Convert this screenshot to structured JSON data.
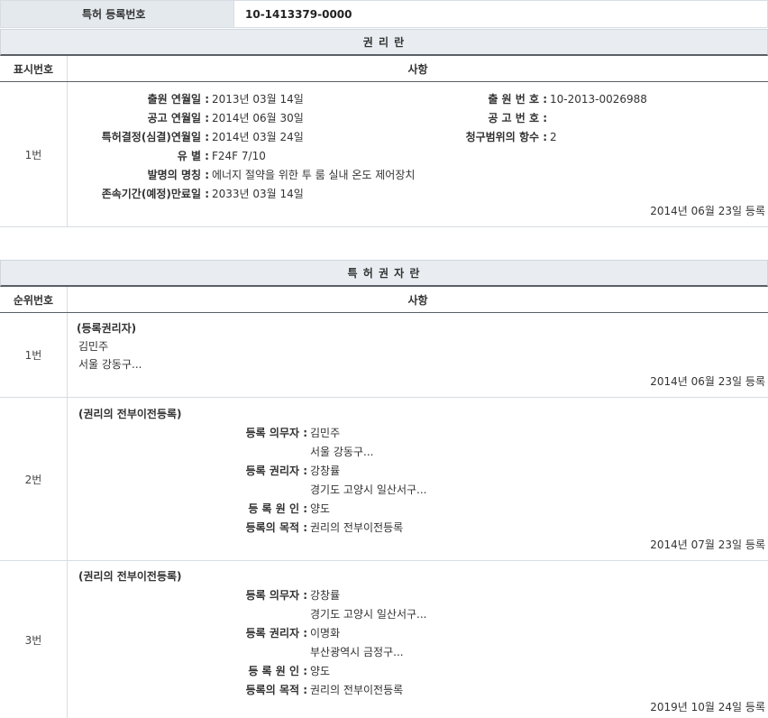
{
  "registration": {
    "label": "특허 등록번호",
    "value": "10-1413379-0000"
  },
  "rights_section": {
    "title": "권 리 란",
    "col_num": "표시번호",
    "col_item": "사항",
    "row": {
      "num": "1번",
      "left": [
        {
          "label": "출원 연월일 :",
          "value": "2013년 03월 14일"
        },
        {
          "label": "공고 연월일 :",
          "value": "2014년 06월 30일"
        },
        {
          "label": "특허결정(심결)연월일 :",
          "value": "2014년 03월 24일"
        },
        {
          "label": "유 별 :",
          "value": "F24F 7/10"
        },
        {
          "label": "발명의 명칭 :",
          "value": "에너지 절약을 위한 투 룸 실내 온도 제어장치"
        },
        {
          "label": "존속기간(예정)만료일 :",
          "value": "2033년 03월 14일"
        }
      ],
      "right": [
        {
          "label": "출 원 번 호 :",
          "value": "10-2013-0026988"
        },
        {
          "label": "공 고 번 호 :",
          "value": ""
        },
        {
          "label": "청구범위의 항수 :",
          "value": "2"
        }
      ],
      "date": "2014년 06월 23일 등록"
    }
  },
  "holder_section": {
    "title": "특 허 권 자 란",
    "col_num": "순위번호",
    "col_item": "사항",
    "rows": [
      {
        "num": "1번",
        "heading": "(등록권리자)",
        "name": "김민주",
        "address": "서울 강동구...",
        "date": "2014년 06월 23일 등록"
      },
      {
        "num": "2번",
        "heading": "(권리의 전부이전등록)",
        "obligor_label": "등록 의무자 :",
        "obligor": "김민주",
        "obligor_addr": "서울 강동구...",
        "holder_label": "등록 권리자 :",
        "holder": "강창률",
        "holder_addr": "경기도 고양시 일산서구...",
        "cause_label": "등 록 원 인 :",
        "cause": "양도",
        "purpose_label": "등록의 목적 :",
        "purpose": "권리의 전부이전등록",
        "date": "2014년 07월 23일 등록"
      },
      {
        "num": "3번",
        "heading": "(권리의 전부이전등록)",
        "obligor_label": "등록 의무자 :",
        "obligor": "강창률",
        "obligor_addr": "경기도 고양시 일산서구...",
        "holder_label": "등록 권리자 :",
        "holder": "이명화",
        "holder_addr": "부산광역시 금정구...",
        "cause_label": "등 록 원 인 :",
        "cause": "양도",
        "purpose_label": "등록의 목적 :",
        "purpose": "권리의 전부이전등록",
        "date": "2019년 10월 24일 등록"
      }
    ]
  }
}
